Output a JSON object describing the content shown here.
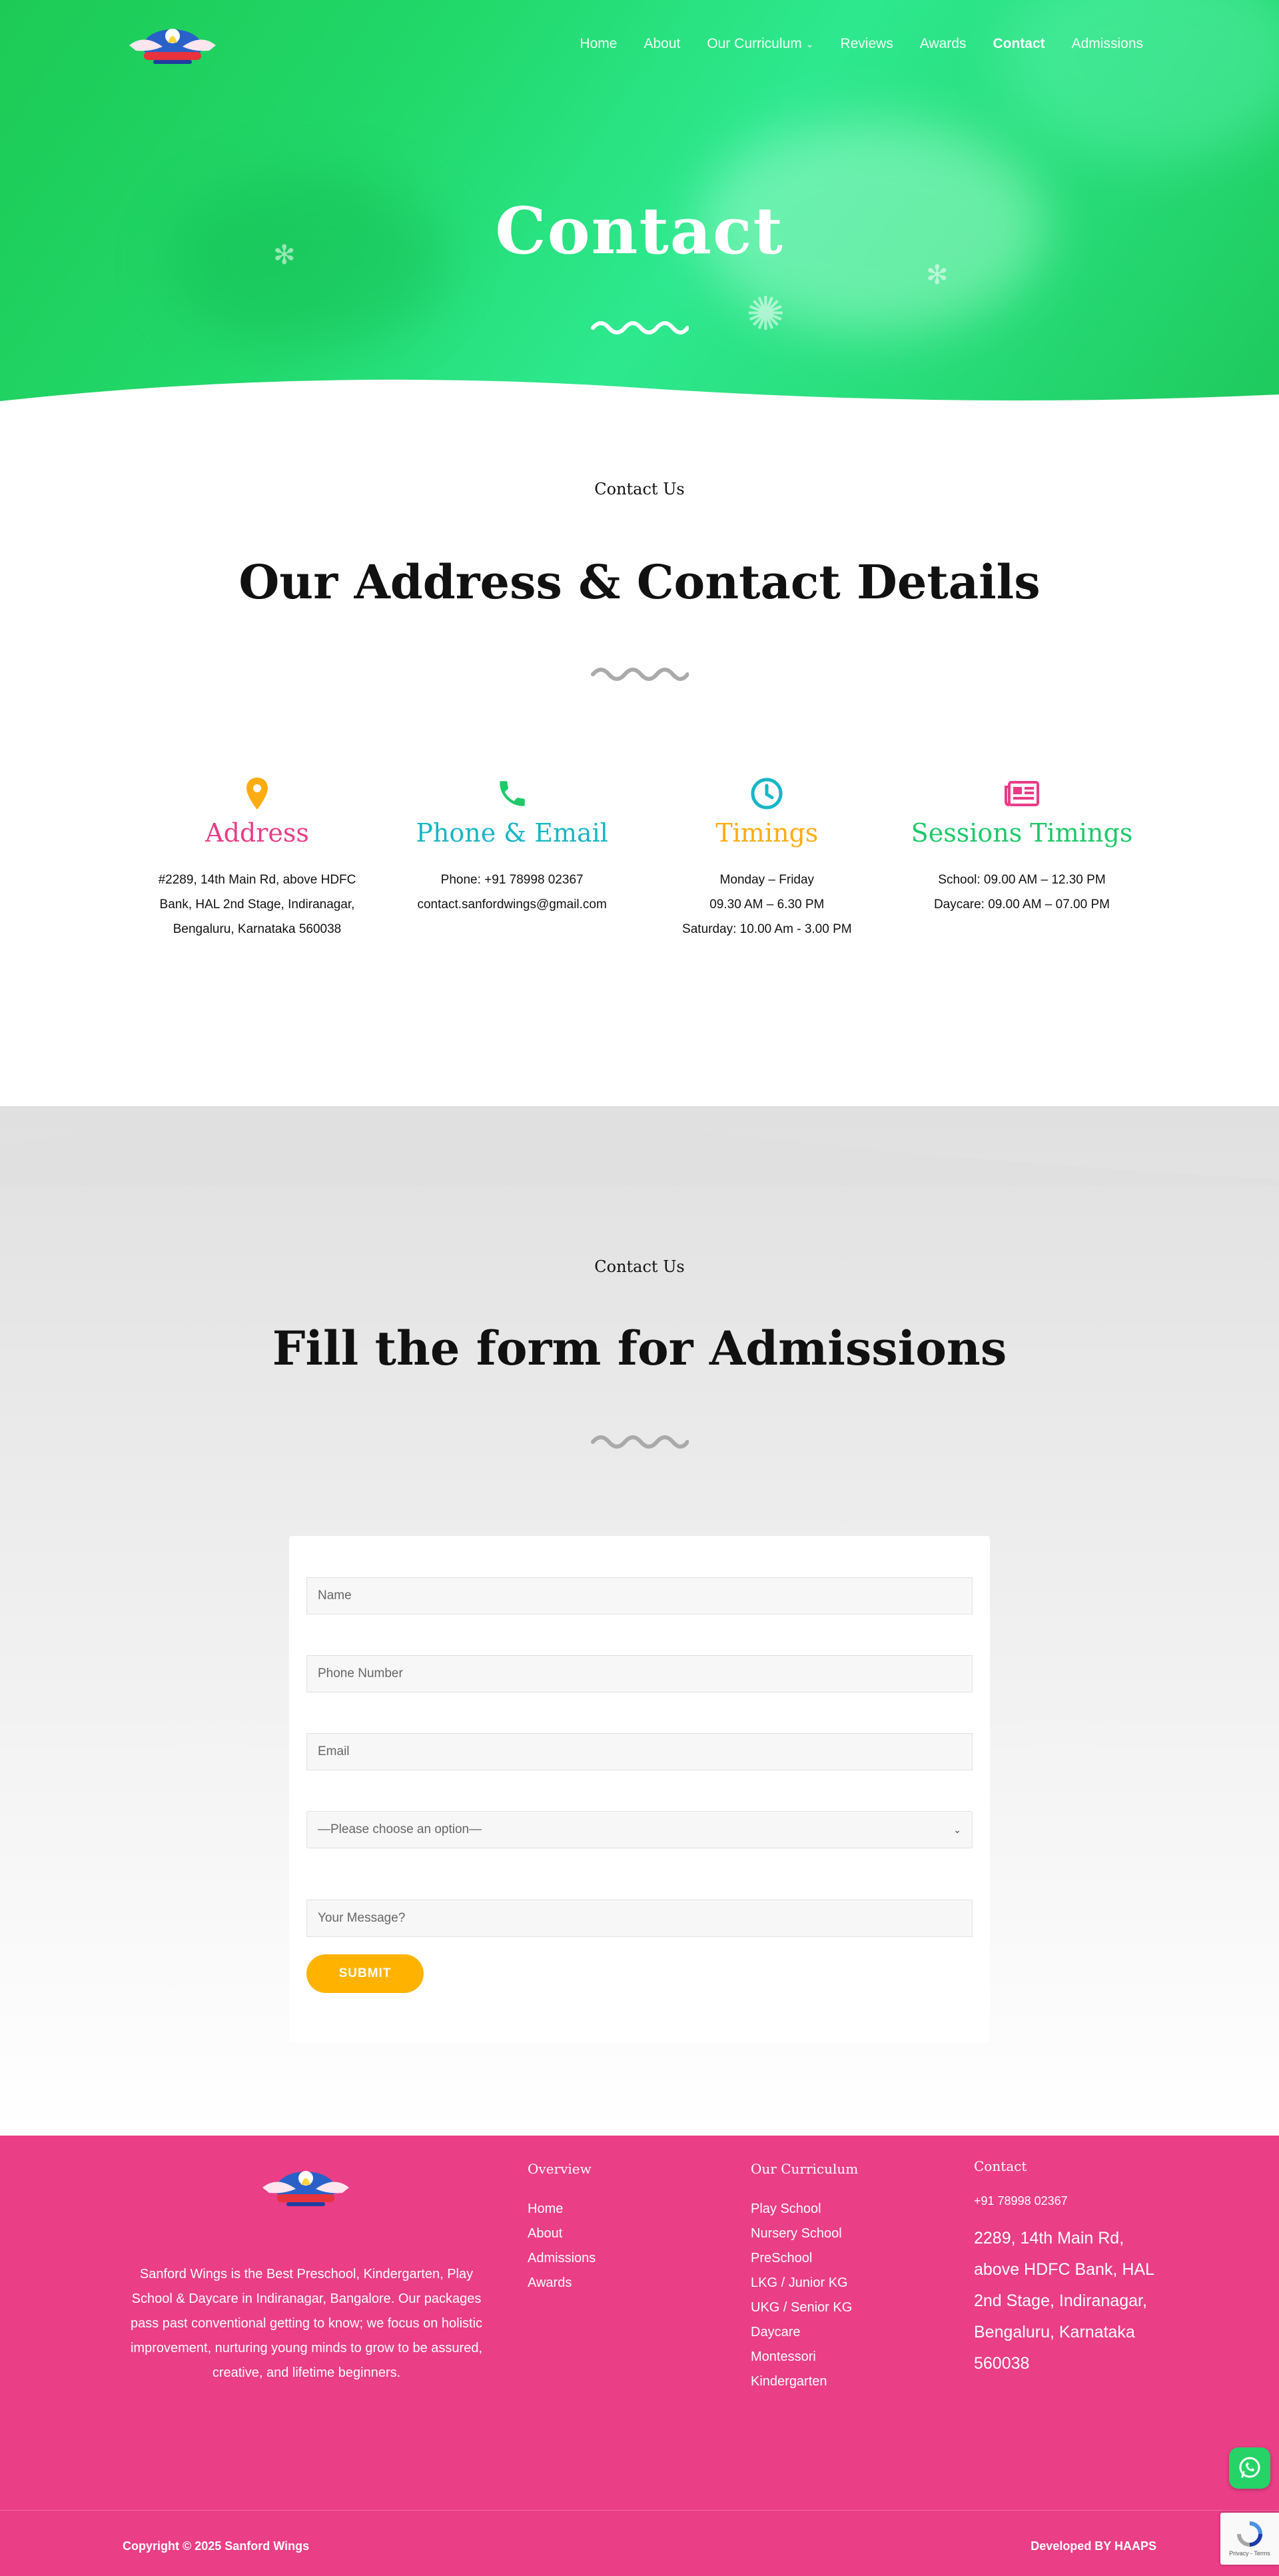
{
  "header": {
    "nav": [
      {
        "label": "Home",
        "active": false,
        "dropdown": false
      },
      {
        "label": "About",
        "active": false,
        "dropdown": false
      },
      {
        "label": "Our Curriculum",
        "active": false,
        "dropdown": true
      },
      {
        "label": "Reviews",
        "active": false,
        "dropdown": false
      },
      {
        "label": "Awards",
        "active": false,
        "dropdown": false
      },
      {
        "label": "Contact",
        "active": true,
        "dropdown": false
      },
      {
        "label": "Admissions",
        "active": false,
        "dropdown": false
      }
    ]
  },
  "hero": {
    "title": "Contact"
  },
  "address_section": {
    "eyebrow": "Contact Us",
    "title": "Our Address & Contact Details",
    "cards": [
      {
        "icon": "map-pin-icon",
        "title": "Address",
        "color": "#e93c86",
        "icon_color": "#ffac12",
        "lines": [
          "#2289, 14th Main Rd, above HDFC",
          "Bank, HAL 2nd Stage, Indiranagar,",
          "Bengaluru, Karnataka 560038"
        ]
      },
      {
        "icon": "phone-icon",
        "title": "Phone & Email",
        "color": "#18b6c4",
        "icon_color": "#1ec96a",
        "lines": [
          "Phone: +91 78998 02367",
          "contact.sanfordwings@gmail.com"
        ]
      },
      {
        "icon": "clock-icon",
        "title": "Timings",
        "color": "#ffac12",
        "icon_color": "#18b6c4",
        "lines": [
          "Monday – Friday",
          "09.30 AM – 6.30 PM",
          "Saturday: 10.00 Am - 3.00 PM"
        ]
      },
      {
        "icon": "newspaper-icon",
        "title": "Sessions Timings",
        "color": "#1ec96a",
        "icon_color": "#e93c86",
        "lines": [
          "School: 09.00 AM – 12.30 PM",
          "Daycare: 09.00 AM – 07.00 PM"
        ]
      }
    ]
  },
  "form_section": {
    "eyebrow": "Contact Us",
    "title": "Fill the form for Admissions",
    "fields": {
      "name_placeholder": "Name",
      "phone_placeholder": "Phone Number",
      "email_placeholder": "Email",
      "select_value": "—Please choose an option—",
      "message_placeholder": "Your Message?"
    },
    "submit_label": "SUBMIT"
  },
  "footer": {
    "about": "Sanford Wings is the Best Preschool, Kindergarten, Play School & Daycare in Indiranagar, Bangalore. Our packages pass past conventional getting to know; we focus on holistic improvement, nurturing young minds to grow to be assured, creative, and lifetime beginners.",
    "overview": {
      "heading": "Overview",
      "links": [
        "Home",
        "About",
        "Admissions",
        "Awards"
      ]
    },
    "curriculum": {
      "heading": "Our Curriculum",
      "links": [
        "Play School",
        "Nursery School",
        "PreSchool",
        "LKG / Junior KG",
        "UKG / Senior KG",
        "Daycare",
        "Montessori",
        "Kindergarten"
      ]
    },
    "contact": {
      "heading": "Contact",
      "phone": "+91 78998 02367",
      "address": "2289, 14th Main Rd, above HDFC Bank, HAL 2nd Stage, Indiranagar, Bengaluru, Karnataka 560038"
    },
    "copyright": "Copyright © 2025 Sanford Wings",
    "developer": "Developed BY HAAPS"
  },
  "widgets": {
    "whatsapp_icon": "whatsapp-icon",
    "recaptcha_text": "Privacy - Terms"
  }
}
